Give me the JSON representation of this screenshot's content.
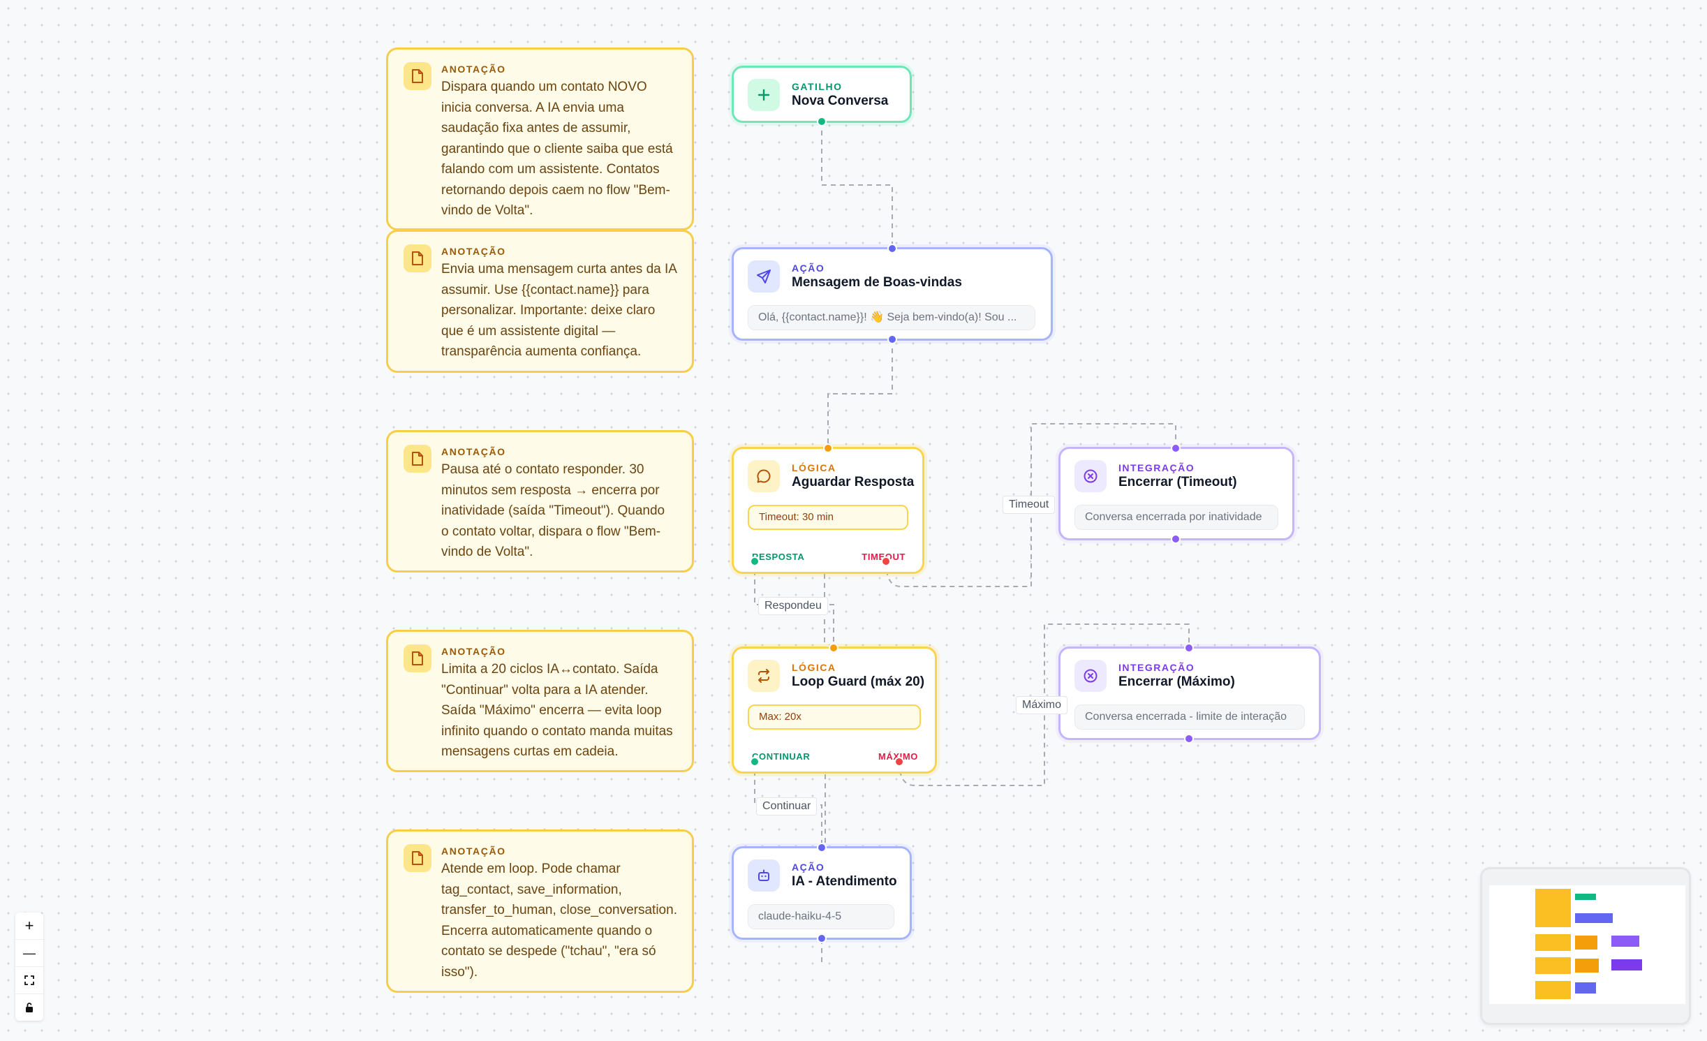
{
  "colors": {
    "annotation_bg": "#fefbe8",
    "annotation_border": "#f7cd4a",
    "trigger": "#10b981",
    "action": "#6366f1",
    "logic": "#f59e0b",
    "integration": "#8b5cf6",
    "exit_ok": "#10b981",
    "exit_bad": "#ef4444"
  },
  "annotations": [
    {
      "label": "ANOTAÇÃO",
      "icon": "file-icon",
      "text": "Dispara quando um contato NOVO\ninicia conversa. A IA envia uma\nsaudação fixa antes de assumir,\ngarantindo que o cliente saiba que está\nfalando com um assistente. Contatos\nretornando depois caem no flow \"Bem-\nvindo de Volta\"."
    },
    {
      "label": "ANOTAÇÃO",
      "icon": "file-icon",
      "text": "Envia uma mensagem curta antes da IA\nassumir. Use {{contact.name}} para\npersonalizar. Importante: deixe claro\nque é um assistente digital —\ntransparência aumenta confiança."
    },
    {
      "label": "ANOTAÇÃO",
      "icon": "file-icon",
      "text": "Pausa até o contato responder. 30\nminutos sem resposta → encerra por\ninatividade (saída \"Timeout\"). Quando\no contato voltar, dispara o flow \"Bem-\nvindo de Volta\"."
    },
    {
      "label": "ANOTAÇÃO",
      "icon": "file-icon",
      "text": "Limita a 20 ciclos IA↔contato. Saída\n\"Continuar\" volta para a IA atender.\nSaída \"Máximo\" encerra — evita loop\ninfinito quando o contato manda muitas\nmensagens curtas em cadeia."
    },
    {
      "label": "ANOTAÇÃO",
      "icon": "file-icon",
      "text": "Atende em loop. Pode chamar\ntag_contact, save_information,\ntransfer_to_human, close_conversation.\nEncerra automaticamente quando o\ncontato se despede (\"tchau\", \"era só\nisso\")."
    }
  ],
  "nodes": {
    "trigger": {
      "kind": "GATILHO",
      "title": "Nova Conversa",
      "icon": "plus-icon"
    },
    "welcome": {
      "kind": "AÇÃO",
      "title": "Mensagem de Boas-vindas",
      "icon": "send-icon",
      "body": "Olá, {{contact.name}}! 👋 Seja bem-vindo(a)! Sou ..."
    },
    "wait": {
      "kind": "LÓGICA",
      "title": "Aguardar Resposta",
      "icon": "message-circle-icon",
      "body": "Timeout: 30 min",
      "exit_ok": "RESPOSTA",
      "exit_bad": "TIMEOUT"
    },
    "timeout_end": {
      "kind": "INTEGRAÇÃO",
      "title": "Encerrar (Timeout)",
      "icon": "x-circle-icon",
      "body": "Conversa encerrada por inatividade"
    },
    "loop": {
      "kind": "LÓGICA",
      "title": "Loop Guard (máx 20)",
      "icon": "repeat-icon",
      "body": "Max: 20x",
      "exit_ok": "CONTINUAR",
      "exit_bad": "MÁXIMO"
    },
    "max_end": {
      "kind": "INTEGRAÇÃO",
      "title": "Encerrar (Máximo)",
      "icon": "x-circle-icon",
      "body": "Conversa encerrada - limite de interação"
    },
    "ai": {
      "kind": "AÇÃO",
      "title": "IA - Atendimento",
      "icon": "bot-icon",
      "body": "claude-haiku-4-5"
    }
  },
  "edge_labels": {
    "timeout": "Timeout",
    "respondeu": "Respondeu",
    "maximo": "Máximo",
    "continuar": "Continuar"
  },
  "controls": {
    "zoom_in": "+",
    "zoom_out": "—",
    "fit_view_icon": "fit-view-icon",
    "lock_icon": "lock-icon"
  }
}
